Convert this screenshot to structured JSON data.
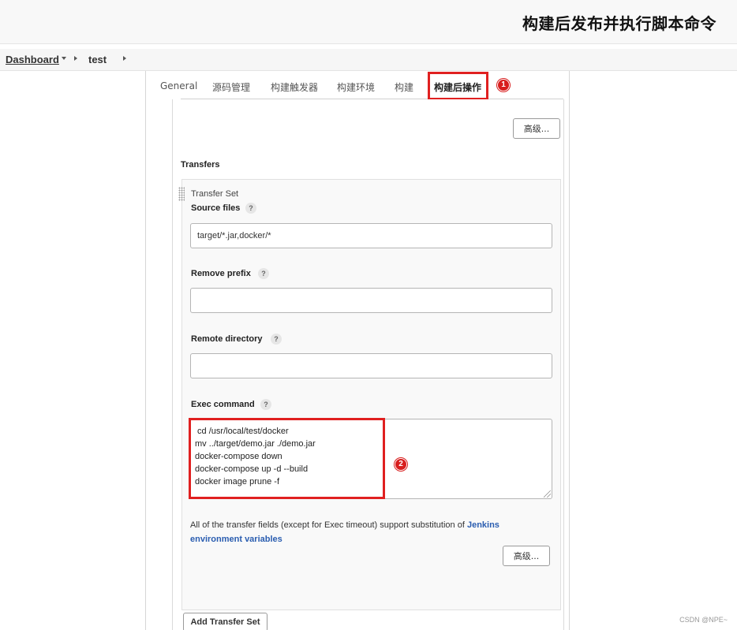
{
  "banner": {
    "title": "构建后发布并执行脚本命令"
  },
  "breadcrumb": {
    "items": [
      "Dashboard",
      "test"
    ]
  },
  "tabs": [
    {
      "label": "General"
    },
    {
      "label": "源码管理"
    },
    {
      "label": "构建触发器"
    },
    {
      "label": "构建环境"
    },
    {
      "label": "构建"
    },
    {
      "label": "构建后操作",
      "active": true
    }
  ],
  "annotations": {
    "badge_1": "1",
    "badge_2": "2",
    "highlight_color": "#e02020"
  },
  "advanced_button_top": "高级...",
  "transfers": {
    "heading": "Transfers",
    "transfer_set_caption": "Transfer Set",
    "source_files": {
      "label": "Source files",
      "help": "?",
      "value": "target/*.jar,docker/*"
    },
    "remove_prefix": {
      "label": "Remove prefix",
      "help": "?",
      "value": ""
    },
    "remote_directory": {
      "label": "Remote directory",
      "help": "?",
      "value": ""
    },
    "exec_command": {
      "label": "Exec command",
      "help": "?",
      "lines": [
        " cd /usr/local/test/docker",
        "mv ../target/demo.jar ./demo.jar",
        "docker-compose down",
        "docker-compose up -d --build",
        "docker image prune -f"
      ]
    },
    "note_text": "All of the transfer fields (except for Exec timeout) support substitution of ",
    "note_link_1": "Jenkins",
    "note_link_2": "environment variables",
    "advanced_button": "高级...",
    "add_transfer_set_button": "Add Transfer Set"
  },
  "watermark": "CSDN @NPE~"
}
